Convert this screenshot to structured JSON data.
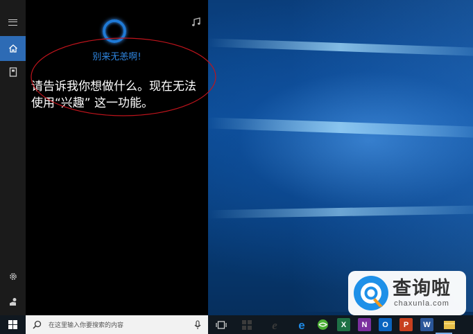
{
  "cortana": {
    "greeting": "别来无恙啊!",
    "message": "请告诉我你想做什么。现在无法使用“兴趣” 这一功能。"
  },
  "rail": {
    "items": [
      {
        "icon": "hamburger-menu-icon"
      },
      {
        "icon": "home-icon",
        "active": true
      },
      {
        "icon": "notebook-icon"
      },
      {
        "icon": "settings-icon"
      },
      {
        "icon": "feedback-icon"
      }
    ]
  },
  "taskbar": {
    "search_placeholder": "在这里输入你要搜索的内容",
    "apps": [
      {
        "icon": "task-view-icon"
      },
      {
        "icon": "store-icon"
      },
      {
        "icon": "internet-explorer-icon"
      },
      {
        "icon": "edge-icon"
      },
      {
        "icon": "browser-360-icon"
      },
      {
        "icon": "excel-icon",
        "letter": "X",
        "color": "#1e7145"
      },
      {
        "icon": "onenote-icon",
        "letter": "N",
        "color": "#7b2f9e"
      },
      {
        "icon": "outlook-icon",
        "letter": "O",
        "color": "#0b64c0"
      },
      {
        "icon": "powerpoint-icon",
        "letter": "P",
        "color": "#c8401f"
      },
      {
        "icon": "word-icon",
        "letter": "W",
        "color": "#2a5699"
      },
      {
        "icon": "explorer-icon"
      }
    ]
  },
  "watermark": {
    "brand_cn": "查询啦",
    "brand_en": "chaxunla.com"
  },
  "colors": {
    "accent": "#2d6bb5",
    "cortana_text": "#2f86e0",
    "annotation": "#c0141c"
  }
}
